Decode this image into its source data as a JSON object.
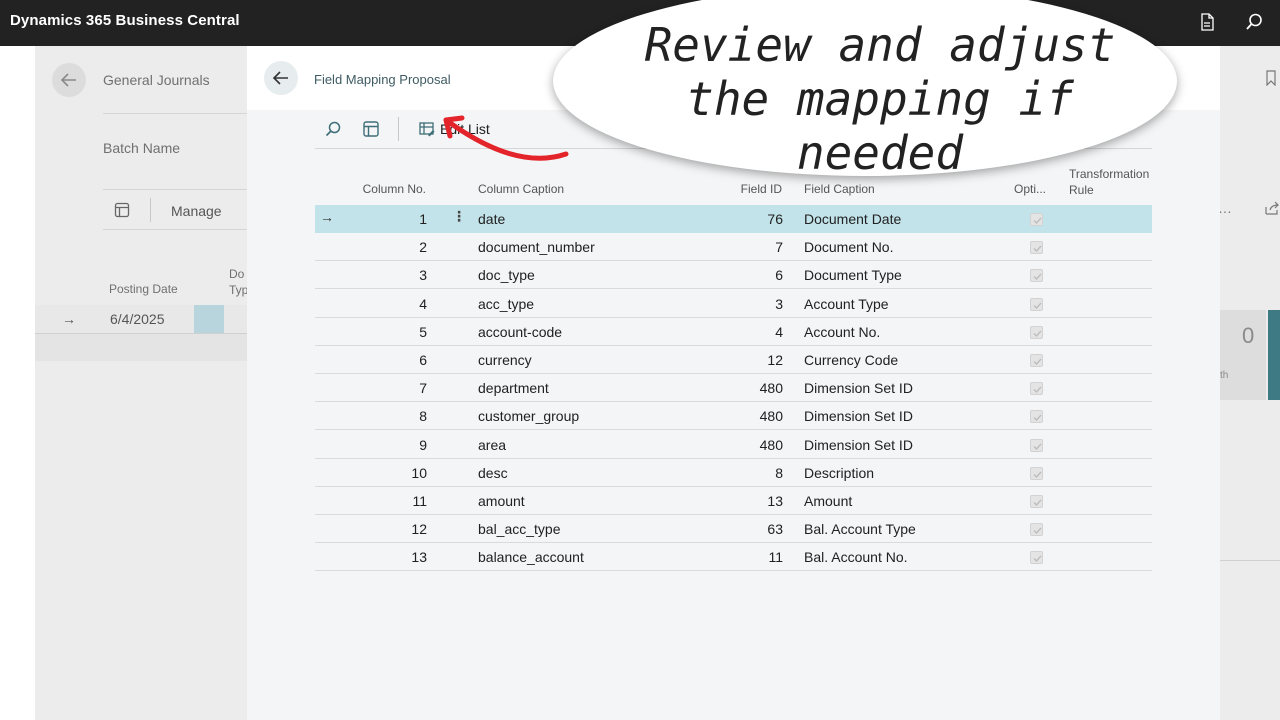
{
  "app": {
    "title": "Dynamics 365 Business Central"
  },
  "background": {
    "title": "General Journals",
    "batch_label": "Batch Name",
    "manage_label": "Manage",
    "posting_date_header": "Posting Date",
    "doc_header": "Do\nTyp",
    "posting_date_value": "6/4/2025",
    "card_value": "0",
    "card_label": "th"
  },
  "dialog": {
    "title": "Field Mapping Proposal",
    "toolbar": {
      "edit_list_label": "Edit List"
    },
    "columns": {
      "column_no": "Column No.",
      "column_caption": "Column Caption",
      "field_id": "Field ID",
      "field_caption": "Field Caption",
      "optional": "Opti...",
      "transformation_rule": "Transformation Rule"
    },
    "rows": [
      {
        "no": "1",
        "caption": "date",
        "field_id": "76",
        "field_caption": "Document Date"
      },
      {
        "no": "2",
        "caption": "document_number",
        "field_id": "7",
        "field_caption": "Document No."
      },
      {
        "no": "3",
        "caption": "doc_type",
        "field_id": "6",
        "field_caption": "Document Type"
      },
      {
        "no": "4",
        "caption": "acc_type",
        "field_id": "3",
        "field_caption": "Account Type"
      },
      {
        "no": "5",
        "caption": "account-code",
        "field_id": "4",
        "field_caption": "Account No."
      },
      {
        "no": "6",
        "caption": "currency",
        "field_id": "12",
        "field_caption": "Currency Code"
      },
      {
        "no": "7",
        "caption": "department",
        "field_id": "480",
        "field_caption": "Dimension Set ID"
      },
      {
        "no": "8",
        "caption": "customer_group",
        "field_id": "480",
        "field_caption": "Dimension Set ID"
      },
      {
        "no": "9",
        "caption": "area",
        "field_id": "480",
        "field_caption": "Dimension Set ID"
      },
      {
        "no": "10",
        "caption": "desc",
        "field_id": "8",
        "field_caption": "Description"
      },
      {
        "no": "11",
        "caption": "amount",
        "field_id": "13",
        "field_caption": "Amount"
      },
      {
        "no": "12",
        "caption": "bal_acc_type",
        "field_id": "63",
        "field_caption": "Bal. Account Type"
      },
      {
        "no": "13",
        "caption": "balance_account",
        "field_id": "11",
        "field_caption": "Bal. Account No."
      }
    ]
  },
  "callout": {
    "line1": "Review and adjust",
    "line2": "the mapping if needed"
  },
  "colors": {
    "topbar": "#222222",
    "selected_row": "#c2e3ea",
    "accent": "#3e5b63",
    "arrow": "#e3242b"
  }
}
